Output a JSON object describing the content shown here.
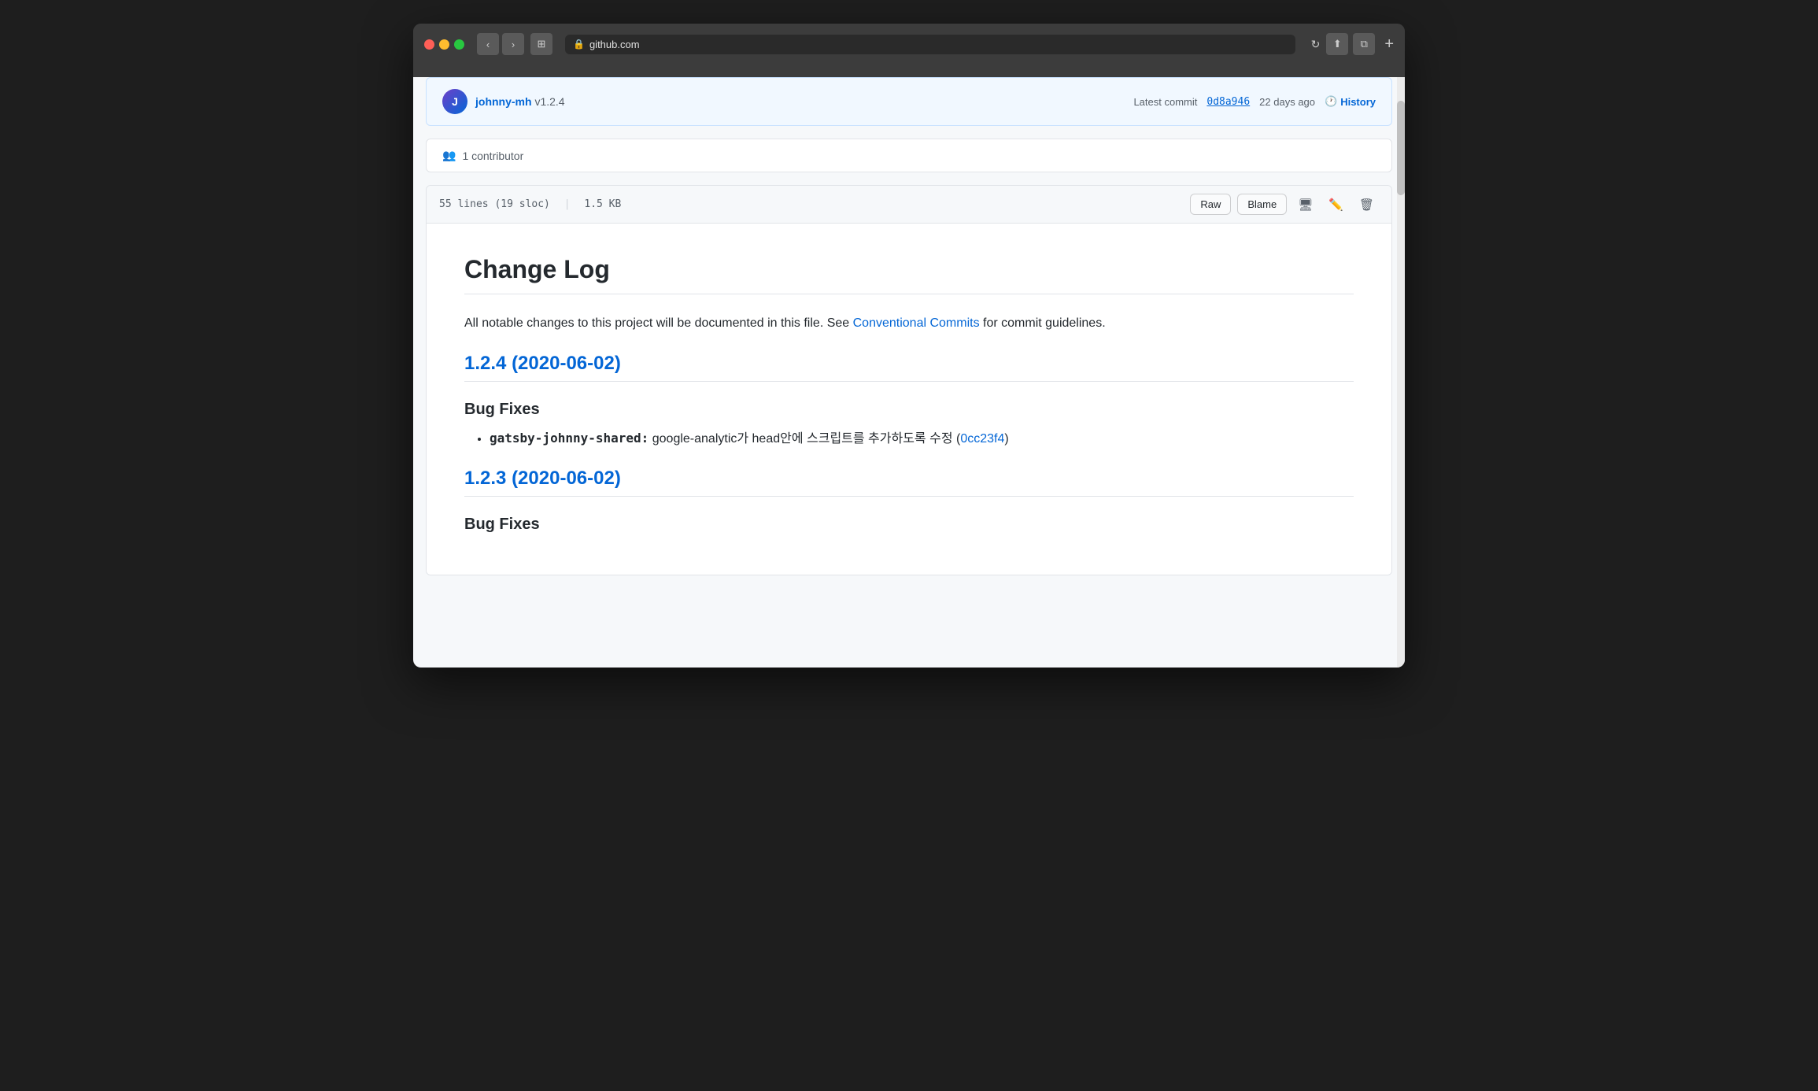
{
  "browser": {
    "url": "github.com",
    "url_icon": "🔒",
    "back_label": "‹",
    "forward_label": "›",
    "tab_label": "⊞",
    "reload_label": "↻",
    "share_label": "⬆",
    "window_label": "⧉",
    "new_tab_label": "+"
  },
  "commit": {
    "author": "johnny-mh",
    "version": "v1.2.4",
    "commit_prefix": "Latest commit",
    "commit_hash": "0d8a946",
    "commit_age": "22 days ago",
    "history_label": "History",
    "avatar_letter": "J"
  },
  "contributor": {
    "icon": "👥",
    "label": "1 contributor"
  },
  "file_header": {
    "lines_info": "55 lines (19 sloc)",
    "separator": "|",
    "size": "1.5 KB",
    "raw_label": "Raw",
    "blame_label": "Blame"
  },
  "changelog": {
    "title": "Change Log",
    "intro_text": "All notable changes to this project will be documented in this file. See ",
    "intro_link_label": "Conventional Commits",
    "intro_suffix": " for commit guidelines.",
    "sections": [
      {
        "version": "1.2.4",
        "version_link": "#",
        "date": "(2020-06-02)",
        "subsections": [
          {
            "heading": "Bug Fixes",
            "items": [
              {
                "package": "gatsby-johnny-shared:",
                "description": " google-analytic가 head안에 스크립트를 추가하도록 수정 (",
                "commit_label": "0cc23f4",
                "commit_link": "#",
                "close_paren": ")"
              }
            ]
          }
        ]
      },
      {
        "version": "1.2.3",
        "version_link": "#",
        "date": "(2020-06-02)",
        "subsections": [
          {
            "heading": "Bug Fixes",
            "items": []
          }
        ]
      }
    ]
  }
}
